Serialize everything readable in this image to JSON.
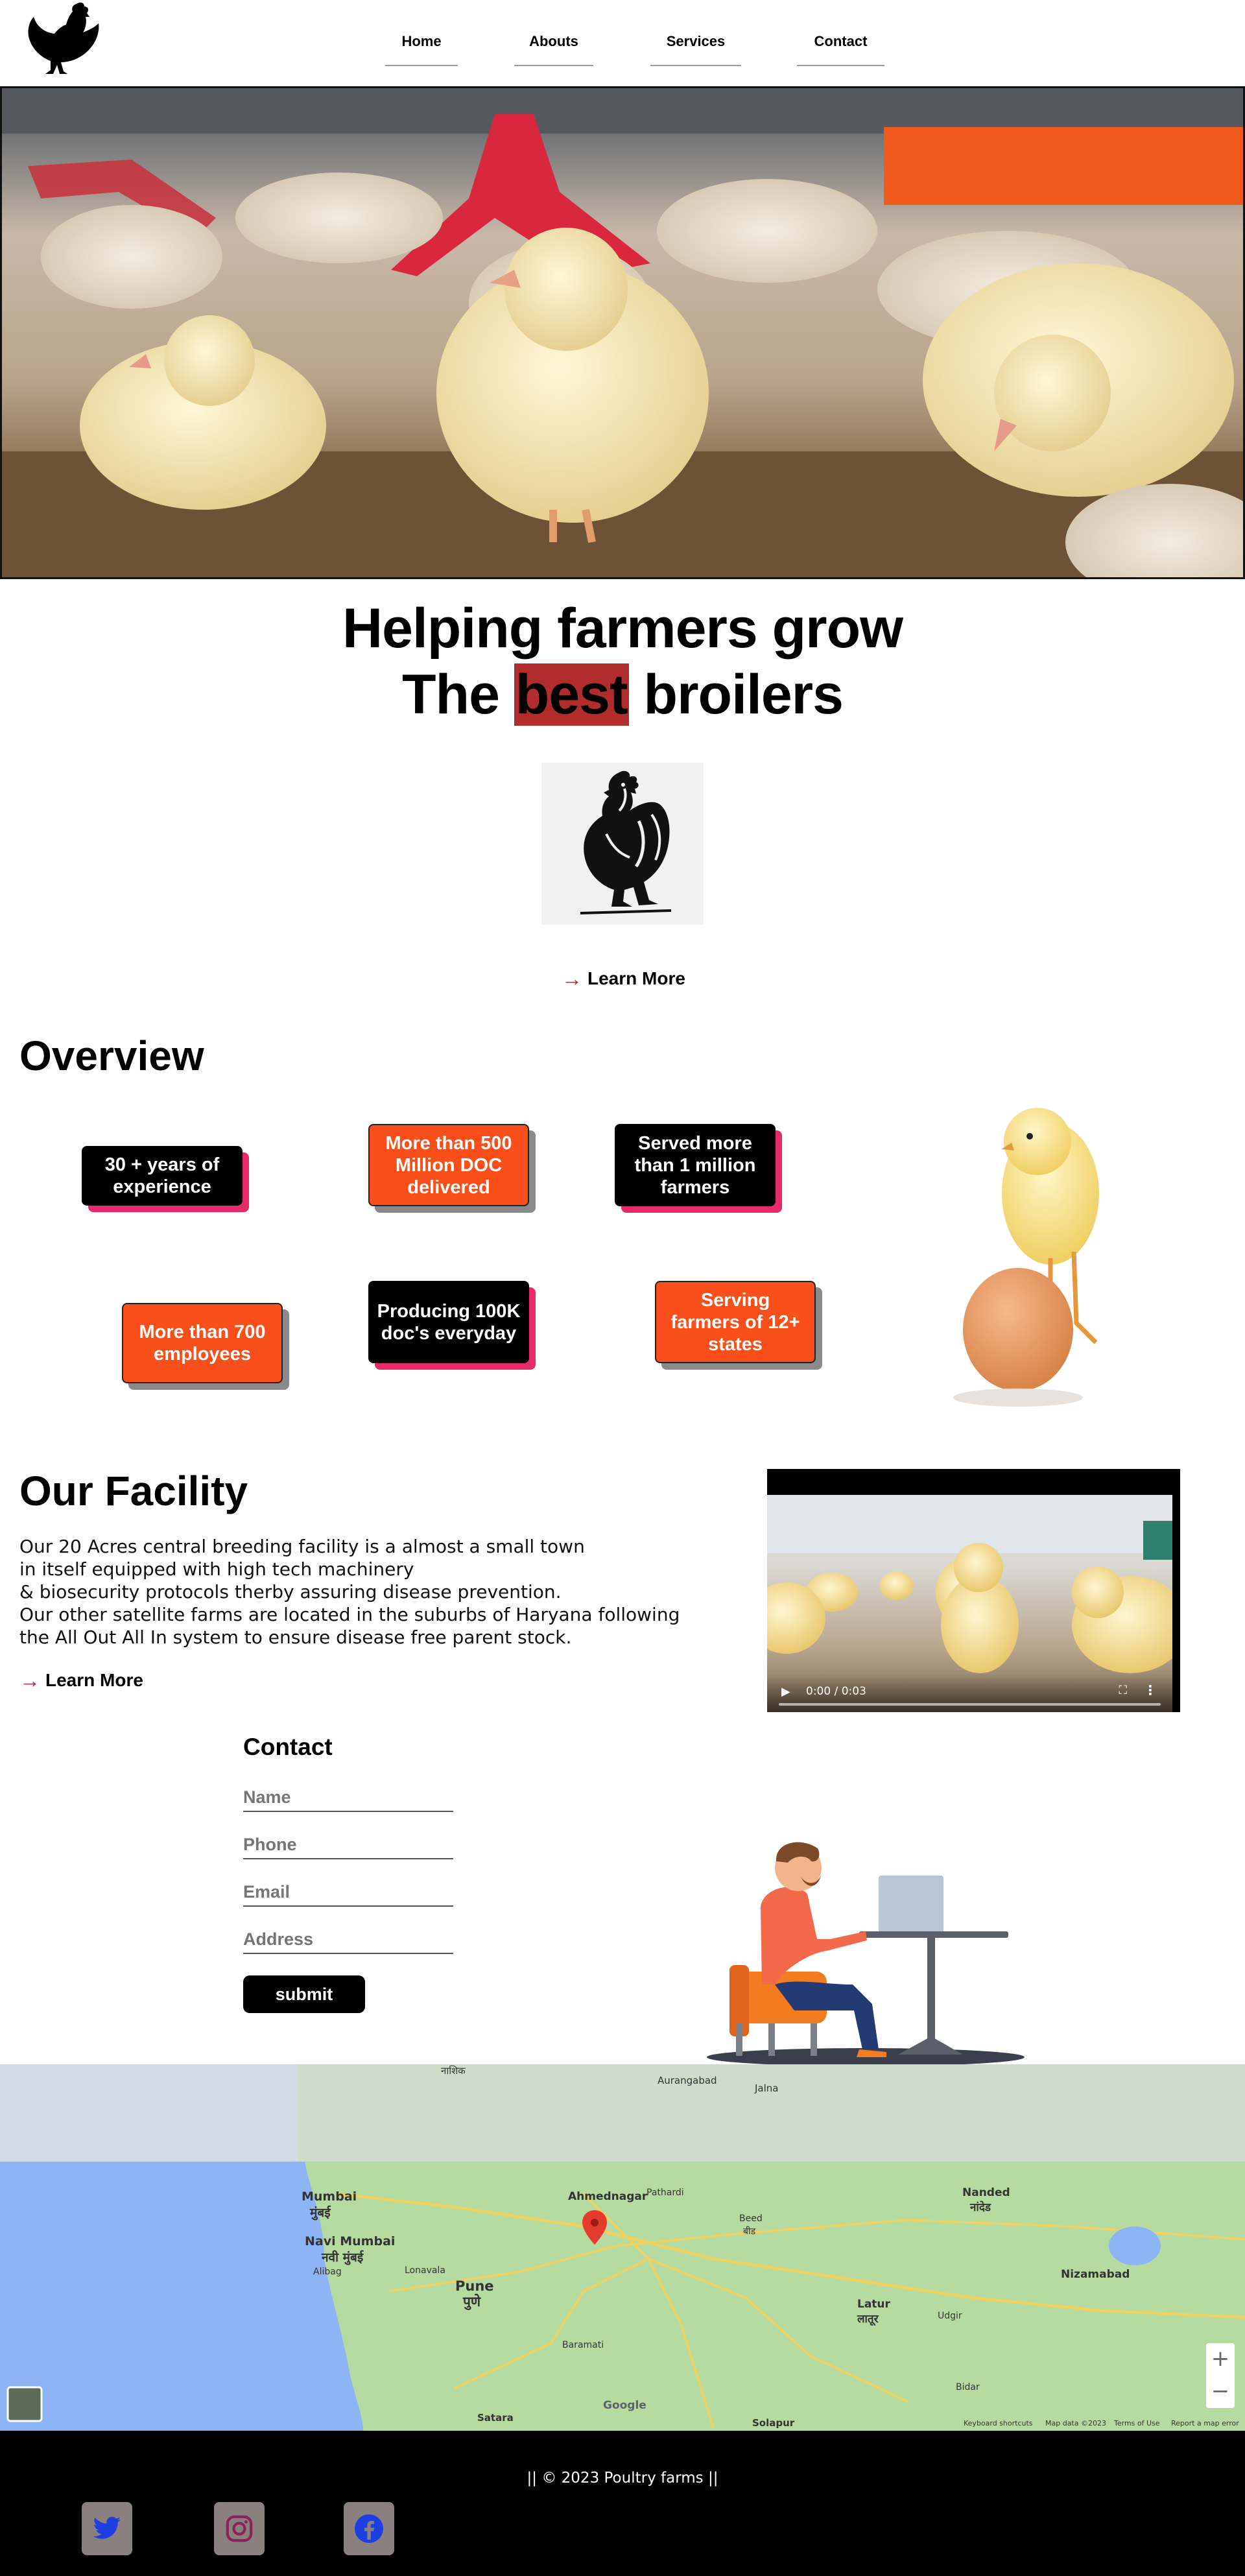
{
  "nav": {
    "items": [
      "Home",
      "Abouts",
      "Services",
      "Contact"
    ]
  },
  "hero": {
    "headline_line1": "Helping farmers grow",
    "headline_pre": "The ",
    "headline_highlight": "best",
    "headline_post": " broilers",
    "learn_more": "Learn More"
  },
  "overview": {
    "title": "Overview",
    "stats": [
      "30 + years of experience",
      "More than 500 Million DOC delivered",
      "Served more than 1 million farmers",
      "More than 700 employees",
      "Producing 100K doc's everyday",
      "Serving farmers of 12+ states"
    ]
  },
  "facility": {
    "title": "Our Facility",
    "lines": [
      "Our 20 Acres central breeding facility is a almost a small town",
      "in itself equipped with high tech machinery",
      "& biosecurity protocols therby assuring disease prevention.",
      "Our other satellite farms are located in the suburbs of Haryana following",
      "the All Out All In system to ensure disease free parent stock."
    ],
    "learn_more": "Learn More",
    "video_time": "0:00 / 0:03"
  },
  "contact": {
    "title": "Contact",
    "fields": {
      "name": "Name",
      "phone": "Phone",
      "email": "Email",
      "address": "Address"
    },
    "submit": "submit"
  },
  "map": {
    "places": [
      "Mumbai",
      "मुंबई",
      "Navi Mumbai",
      "नवी मुंबई",
      "Pune",
      "पुणे",
      "Ahmednagar",
      "Latur",
      "लातूर",
      "Nanded",
      "नांदेड",
      "Nizamabad",
      "Aurangabad",
      "Jalna",
      "नाशिक",
      "Satara",
      "Solapur",
      "Beed",
      "बीड",
      "Alibag",
      "Lonavala",
      "Baramati",
      "Pathardi",
      "Udgir",
      "Bidar"
    ],
    "footer_links": [
      "Keyboard shortcuts",
      "Map data ©2023",
      "Terms of Use",
      "Report a map error"
    ],
    "brand": "Google"
  },
  "footer": {
    "copyright": "|| © 2023 Poultry farms ||"
  },
  "colors": {
    "accent_red": "#b12c2c",
    "stat_orange": "#fa4f1a",
    "stat_pink_shadow": "#e8296b",
    "social_bg": "#8a8080"
  }
}
